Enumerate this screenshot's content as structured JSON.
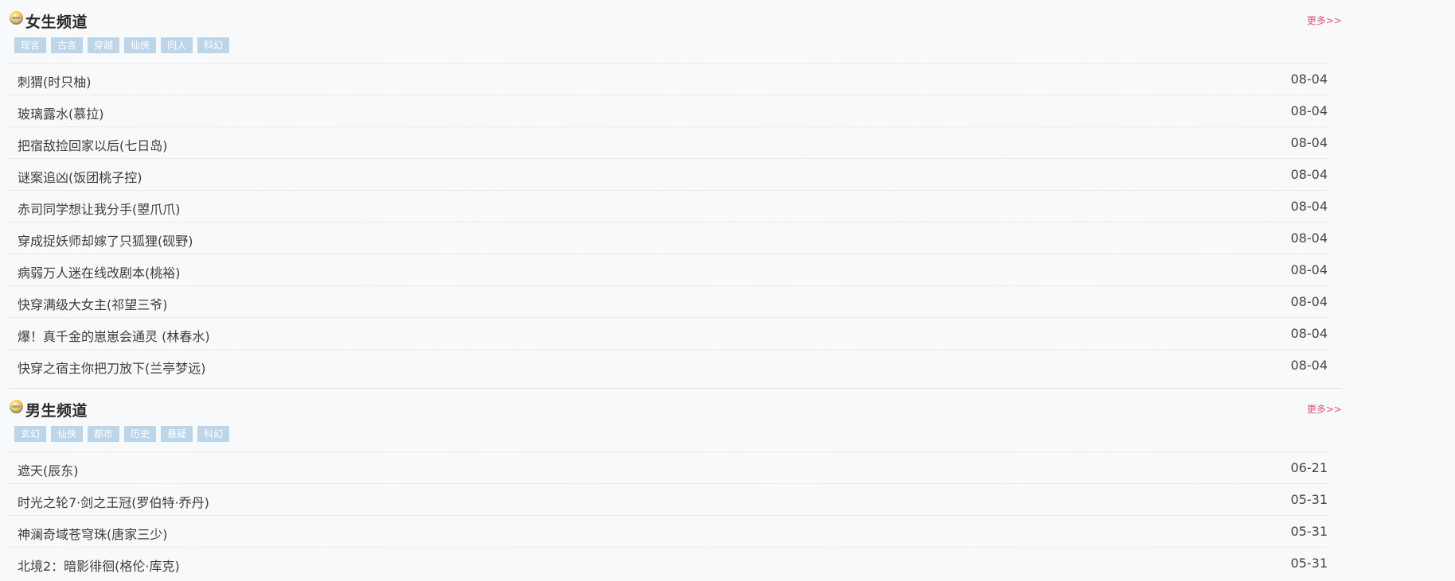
{
  "sections": [
    {
      "title": "女生频道",
      "more": "更多>>",
      "tags": [
        "现言",
        "古言",
        "穿越",
        "仙侠",
        "同人",
        "科幻"
      ],
      "rows": [
        {
          "title": "刺猬(时只柚)",
          "date": "08-04"
        },
        {
          "title": "玻璃露水(慕拉)",
          "date": "08-04"
        },
        {
          "title": "把宿敌捡回家以后(七日岛)",
          "date": "08-04"
        },
        {
          "title": "谜案追凶(饭团桃子控)",
          "date": "08-04"
        },
        {
          "title": "赤司同学想让我分手(曌爪爪)",
          "date": "08-04"
        },
        {
          "title": "穿成捉妖师却嫁了只狐狸(砚野)",
          "date": "08-04"
        },
        {
          "title": "病弱万人迷在线改剧本(桃裕)",
          "date": "08-04"
        },
        {
          "title": "快穿满级大女主(祁望三爷)",
          "date": "08-04"
        },
        {
          "title": "爆！真千金的崽崽会通灵 (林春水)",
          "date": "08-04"
        },
        {
          "title": "快穿之宿主你把刀放下(兰亭梦远)",
          "date": "08-04"
        }
      ]
    },
    {
      "title": "男生频道",
      "more": "更多>>",
      "tags": [
        "玄幻",
        "仙侠",
        "都市",
        "历史",
        "悬疑",
        "科幻"
      ],
      "rows": [
        {
          "title": "遮天(辰东)",
          "date": "06-21"
        },
        {
          "title": "时光之轮7·剑之王冠(罗伯特·乔丹)",
          "date": "05-31"
        },
        {
          "title": "神澜奇域苍穹珠(唐家三少)",
          "date": "05-31"
        },
        {
          "title": "北境2：暗影徘徊(格伦·库克)",
          "date": "05-31"
        }
      ]
    }
  ]
}
